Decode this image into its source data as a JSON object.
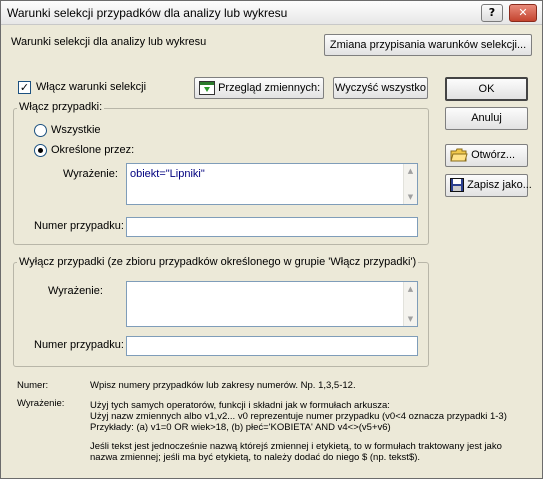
{
  "window": {
    "title": "Warunki selekcji przypadków dla analizy lub wykresu",
    "help_glyph": "?",
    "close_glyph": "✕"
  },
  "header": {
    "label": "Warunki selekcji dla analizy lub wykresu",
    "change_button": "Zmiana przypisania warunków selekcji..."
  },
  "enable_selection": {
    "label": "Włącz warunki selekcji",
    "checked": true
  },
  "toolbar": {
    "review_vars": "Przegląd zmiennych:",
    "clear_all": "Wyczyść wszystko"
  },
  "include_group": {
    "title": "Włącz przypadki:",
    "option_all": "Wszystkie",
    "option_specified": "Określone przez:",
    "selected": "specified",
    "expr_label": "Wyrażenie:",
    "expr_value": "obiekt=\"Lipniki\"",
    "casenum_label": "Numer przypadku:",
    "casenum_value": ""
  },
  "exclude_group": {
    "title": "Wyłącz przypadki (ze zbioru przypadków określonego w grupie 'Włącz przypadki')",
    "expr_label": "Wyrażenie:",
    "expr_value": "",
    "casenum_label": "Numer przypadku:",
    "casenum_value": ""
  },
  "side_buttons": {
    "ok": "OK",
    "cancel": "Anuluj",
    "open": "Otwórz...",
    "save": "Zapisz jako..."
  },
  "help": {
    "num_key": "Numer:",
    "num_text": "Wpisz numery przypadków lub zakresy numerów.  Np.   1,3,5-12.",
    "expr_key": "Wyrażenie:",
    "line1": "Użyj tych samych operatorów, funkcji i składni jak w formułach arkusza:",
    "line2": "Użyj nazw zmiennych albo v1,v2...    v0 reprezentuje numer przypadku (v0<4 oznacza przypadki 1-3)",
    "line3": "Przykłady: (a)  v1=0 OR wiek>18,    (b)  płeć='KOBIETA' AND  v4<>(v5+v6)",
    "line4": "Jeśli tekst jest jednocześnie nazwą którejś zmiennej i etykietą, to w formułach traktowany jest jako",
    "line5": "nazwa zmiennej; jeśli ma być etykietą, to należy dodać do niego $ (np. tekst$)."
  }
}
